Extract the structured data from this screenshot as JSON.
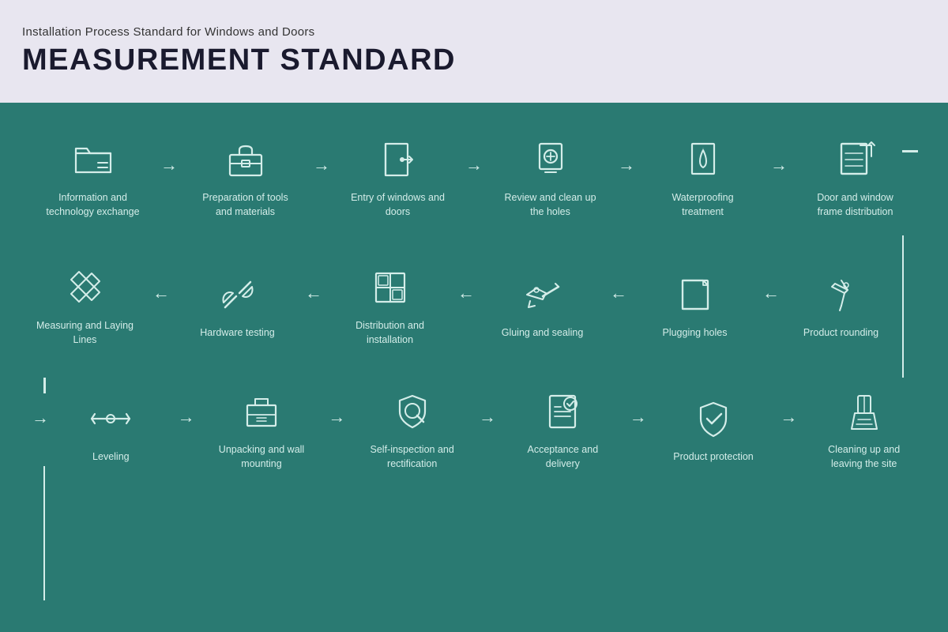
{
  "header": {
    "subtitle": "Installation Process Standard for Windows and Doors",
    "title": "MEASUREMENT STANDARD"
  },
  "rows": [
    {
      "id": "row1",
      "steps": [
        {
          "id": "info-tech",
          "label": "Information and technology exchange",
          "icon": "folder"
        },
        {
          "id": "prep-tools",
          "label": "Preparation of tools and materials",
          "icon": "toolbox"
        },
        {
          "id": "entry-windows",
          "label": "Entry of windows and doors",
          "icon": "door-entry"
        },
        {
          "id": "review-holes",
          "label": "Review and clean up the holes",
          "icon": "magnifier"
        },
        {
          "id": "waterproofing",
          "label": "Waterproofing treatment",
          "icon": "waterproof"
        },
        {
          "id": "frame-dist",
          "label": "Door and window frame distribution",
          "icon": "frame-dist"
        }
      ]
    },
    {
      "id": "row2",
      "steps": [
        {
          "id": "measuring",
          "label": "Measuring and Laying Lines",
          "icon": "measuring"
        },
        {
          "id": "hardware",
          "label": "Hardware testing",
          "icon": "hardware"
        },
        {
          "id": "distribution",
          "label": "Distribution and installation",
          "icon": "distribution"
        },
        {
          "id": "gluing",
          "label": "Gluing and sealing",
          "icon": "gluing"
        },
        {
          "id": "plugging",
          "label": "Plugging holes",
          "icon": "plugging"
        },
        {
          "id": "rounding",
          "label": "Product rounding",
          "icon": "rounding"
        }
      ]
    },
    {
      "id": "row3",
      "steps": [
        {
          "id": "leveling",
          "label": "Leveling",
          "icon": "leveling"
        },
        {
          "id": "unpacking",
          "label": "Unpacking and wall mounting",
          "icon": "unpacking"
        },
        {
          "id": "self-inspect",
          "label": "Self-inspection and rectification",
          "icon": "self-inspect"
        },
        {
          "id": "acceptance",
          "label": "Acceptance and delivery",
          "icon": "acceptance"
        },
        {
          "id": "protection",
          "label": "Product protection",
          "icon": "protection"
        },
        {
          "id": "cleanup",
          "label": "Cleaning up and leaving the site",
          "icon": "cleanup"
        }
      ]
    }
  ]
}
